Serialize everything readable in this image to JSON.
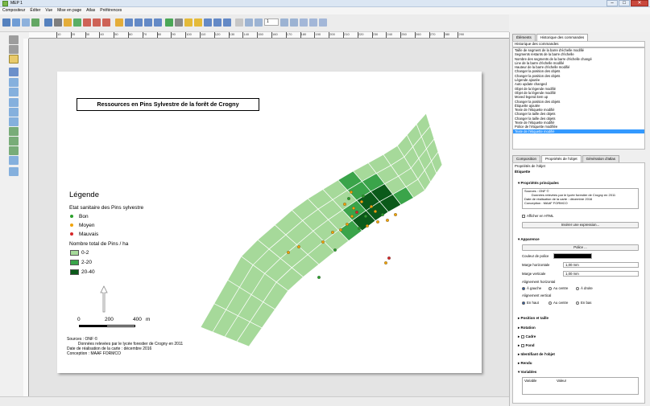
{
  "window": {
    "title": "MEP 1"
  },
  "menu": [
    "Compositeur",
    "Éditer",
    "Vue",
    "Mise en page",
    "Atlas",
    "Préférences"
  ],
  "toolbar": {
    "icons": [
      "new-composer-icon",
      "duplicate-icon",
      "composer-manager-icon",
      "load-template-icon",
      "save-template-icon",
      "print-icon",
      "export-image-icon",
      "export-svg-icon",
      "export-pdf-icon",
      "undo-icon",
      "redo-icon",
      "zoom-full-icon",
      "zoom-100-icon",
      "zoom-in-icon",
      "zoom-out-icon",
      "refresh-icon",
      "group-icon",
      "ungroup-icon",
      "lock-icon",
      "unlock-icon",
      "raise-icon",
      "lower-icon",
      "align-icon",
      "atlas-preview-icon",
      "first-feature-icon",
      "prev-feature-icon",
      "next-feature-icon",
      "last-feature-icon",
      "print-atlas-icon",
      "export-atlas-icon",
      "atlas-settings-icon"
    ],
    "atlas_page_value": "1"
  },
  "ruler_h": [
    "10",
    "20",
    "30",
    "40",
    "50",
    "60",
    "70",
    "80",
    "90",
    "100",
    "110",
    "120",
    "130",
    "140",
    "150",
    "160",
    "170",
    "180",
    "190",
    "200",
    "210",
    "220",
    "230",
    "240",
    "250",
    "260",
    "270",
    "280",
    "290"
  ],
  "left_tools": [
    "pan-icon",
    "zoom-icon",
    "select-icon",
    "move-content-icon",
    "add-map-icon",
    "add-image-icon",
    "add-label-icon",
    "add-legend-icon",
    "add-scalebar-icon",
    "add-shape-icon",
    "add-arrow-icon",
    "add-node-icon",
    "add-table-icon",
    "add-html-icon"
  ],
  "page": {
    "map_title": "Ressources en Pins Sylvestre de la forêt de Crogny",
    "legend_title": "Légende",
    "legend_subtitle": "Etat sanitaire des Pins sylvestre",
    "points": [
      {
        "label": "Bon",
        "color": "#2ca02c"
      },
      {
        "label": "Moyen",
        "color": "#f0a30a"
      },
      {
        "label": "Mauvais",
        "color": "#d62728"
      }
    ],
    "density_title": "Nombre total de Pins / ha",
    "classes": [
      {
        "label": "0-2",
        "color": "#a6d99a"
      },
      {
        "label": "2-20",
        "color": "#3aa44a"
      },
      {
        "label": "20-40",
        "color": "#0b5a1a"
      }
    ],
    "scale": [
      "0",
      "200",
      "400",
      "m"
    ],
    "sources": "Sources : ONF ©\n          Données relevées par le lycée forestier de Crogny en 2011\nDate de réalisation de la carte : décembre 2016\nConception : MAAF FORMCO"
  },
  "panel": {
    "top_tabs": [
      "Éléments",
      "Historique des commandes"
    ],
    "history_header": "Historique des commandes",
    "history": [
      "Taille de segment de la barre d'échelle modifié",
      "Segments restants de la barre d'échelle",
      "Nombre des segments de la barre d'échelle changé",
      "Line de la barre d'échelle modifié",
      "Hauteur de la barre d'échelle modifié",
      "Changer la position des objets",
      "Changer la position des objets",
      "Légende ajoutée",
      "Auto update changed",
      "Objet de la légende modifié",
      "Objet de la légende modifié",
      "Moved legend item up",
      "Changer la position des objets",
      "Étiquette ajoutée",
      "Texte de l'étiquette modifié",
      "Changer la taille des objets",
      "Changer la taille des objets",
      "Texte de l'étiquette modifié",
      "Police de l'étiquette modifiée",
      "Texte de l'étiquette modifié"
    ],
    "bottom_tabs": [
      "Composition",
      "Propriétés de l'objet",
      "Génération d'atlas"
    ],
    "props_header": "Propriétés de l'objet",
    "section_label": "Étiquette",
    "main_props": "Propriétés principales",
    "label_text": "Sources : ONF ©\n        Données relevées par le lycée forestier de Crogny en 2011\nDate de réalisation de la carte : décembre 2016\nConception : MAAF FORMCO",
    "html_checkbox": "Afficher en HTML",
    "insert_expr": "Insérer une expression...",
    "appearance": "Apparence",
    "font_button": "Police ...",
    "font_color_label": "Couleur de police",
    "h_margin_label": "Marge horizontale",
    "h_margin_value": "1,00 mm",
    "v_margin_label": "Marge verticale",
    "v_margin_value": "1,00 mm",
    "h_align_label": "Alignement horizontal",
    "h_align": [
      "À gauche",
      "Au centre",
      "À droite"
    ],
    "v_align_label": "Alignement vertical",
    "v_align": [
      "En haut",
      "Au centre",
      "En bas"
    ],
    "collapsed": [
      "Position et taille",
      "Rotation",
      "Cadre",
      "Fond",
      "Identifiant de l'objet",
      "Rendu"
    ],
    "variables": "Variables",
    "var_cols": [
      "Variable",
      "Valeur"
    ]
  }
}
